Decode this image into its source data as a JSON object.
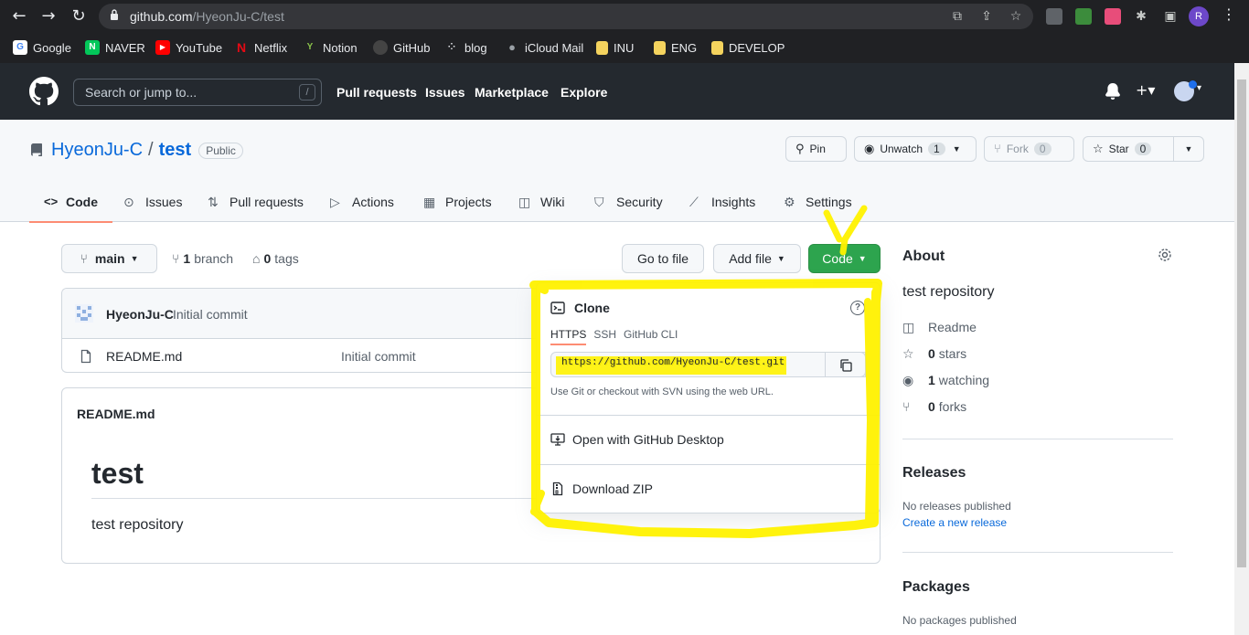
{
  "browser": {
    "url_host": "github.com",
    "url_path": "/HyeonJu-C/test",
    "profile_initial": "R",
    "bookmarks": [
      {
        "label": "Google",
        "color": "#4285f4",
        "glyph": "G"
      },
      {
        "label": "NAVER",
        "color": "#03c75a",
        "glyph": "N"
      },
      {
        "label": "YouTube",
        "color": "#ff0000",
        "glyph": "▶"
      },
      {
        "label": "Netflix",
        "color": "#e50914",
        "glyph": "N"
      },
      {
        "label": "Notion",
        "color": "#8ac34a",
        "glyph": "🌱"
      },
      {
        "label": "GitHub",
        "color": "#444444",
        "glyph": "●"
      },
      {
        "label": "blog",
        "color": "#202124",
        "glyph": "⁘"
      },
      {
        "label": "iCloud Mail",
        "color": "#9aa0a6",
        "glyph": ""
      },
      {
        "label": "INU",
        "color": "#f4d35e",
        "glyph": ""
      },
      {
        "label": "ENG",
        "color": "#f4d35e",
        "glyph": ""
      },
      {
        "label": "DEVELOP",
        "color": "#f4d35e",
        "glyph": ""
      }
    ]
  },
  "gh": {
    "search_placeholder": "Search or jump to...",
    "search_key": "/",
    "nav": [
      "Pull requests",
      "Issues",
      "Marketplace",
      "Explore"
    ]
  },
  "repo": {
    "owner": "HyeonJu-C",
    "separator": "/",
    "name": "test",
    "visibility": "Public",
    "pin": "Pin",
    "unwatch": "Unwatch",
    "unwatch_count": "1",
    "fork": "Fork",
    "fork_count": "0",
    "star": "Star",
    "star_count": "0",
    "tabs": [
      "Code",
      "Issues",
      "Pull requests",
      "Actions",
      "Projects",
      "Wiki",
      "Security",
      "Insights",
      "Settings"
    ]
  },
  "main": {
    "branch": "main",
    "branch_count": "1",
    "branch_label": "branch",
    "tag_count": "0",
    "tag_label": "tags",
    "go_to_file": "Go to file",
    "add_file": "Add file",
    "code": "Code",
    "commit_author": "HyeonJu-C",
    "commit_msg": "Initial commit",
    "files": [
      {
        "name": "README.md",
        "msg": "Initial commit"
      }
    ],
    "readme_title": "README.md",
    "readme_h1": "test",
    "readme_desc": "test repository"
  },
  "dropdown": {
    "clone": "Clone",
    "help": "?",
    "tabs": [
      "HTTPS",
      "SSH",
      "GitHub CLI"
    ],
    "url": "https://github.com/HyeonJu-C/test.git",
    "help_text": "Use Git or checkout with SVN using the web URL.",
    "desktop": "Open with GitHub Desktop",
    "zip": "Download ZIP"
  },
  "sidebar": {
    "about": "About",
    "description": "test repository",
    "readme": "Readme",
    "stars_count": "0",
    "stars_label": "stars",
    "watching_count": "1",
    "watching_label": "watching",
    "forks_count": "0",
    "forks_label": "forks",
    "releases": "Releases",
    "no_releases": "No releases published",
    "create_release": "Create a new release",
    "packages": "Packages",
    "no_packages": "No packages published"
  },
  "colors": {
    "accent": "#0969da",
    "green": "#2da44e",
    "highlight": "#fff200",
    "tab_underline": "#fd8c73"
  }
}
